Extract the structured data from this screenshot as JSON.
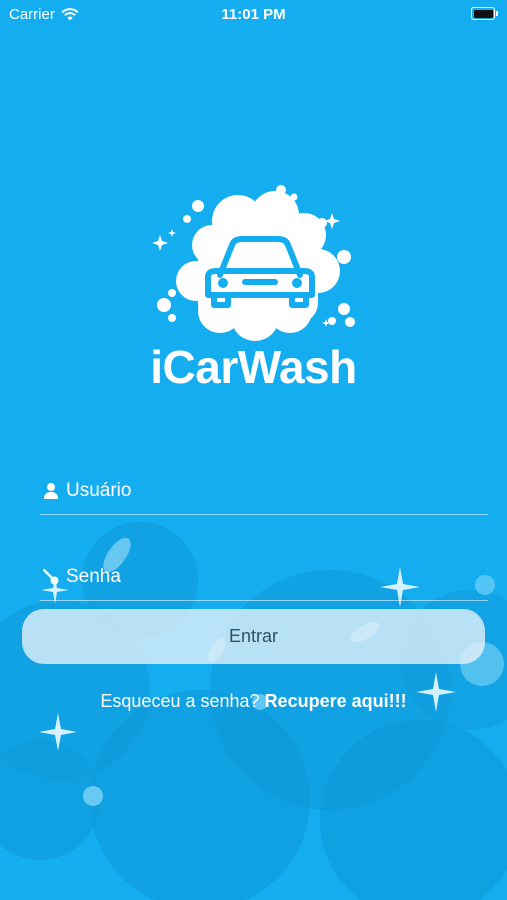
{
  "status_bar": {
    "carrier": "Carrier",
    "time": "11:01 PM"
  },
  "app": {
    "name": "iCarWash"
  },
  "login": {
    "username_placeholder": "Usuário",
    "password_placeholder": "Senha",
    "submit_label": "Entrar",
    "forgot_text": "Esqueceu a senha?",
    "recover_link": "Recupere aqui!!!"
  },
  "icons": [
    "wifi-icon",
    "battery-icon",
    "car-wash-logo-icon",
    "user-icon",
    "key-icon"
  ],
  "colors": {
    "background": "#14aef0",
    "text": "#ffffff",
    "button": "#e8f2fa",
    "button_text": "#33505f"
  }
}
